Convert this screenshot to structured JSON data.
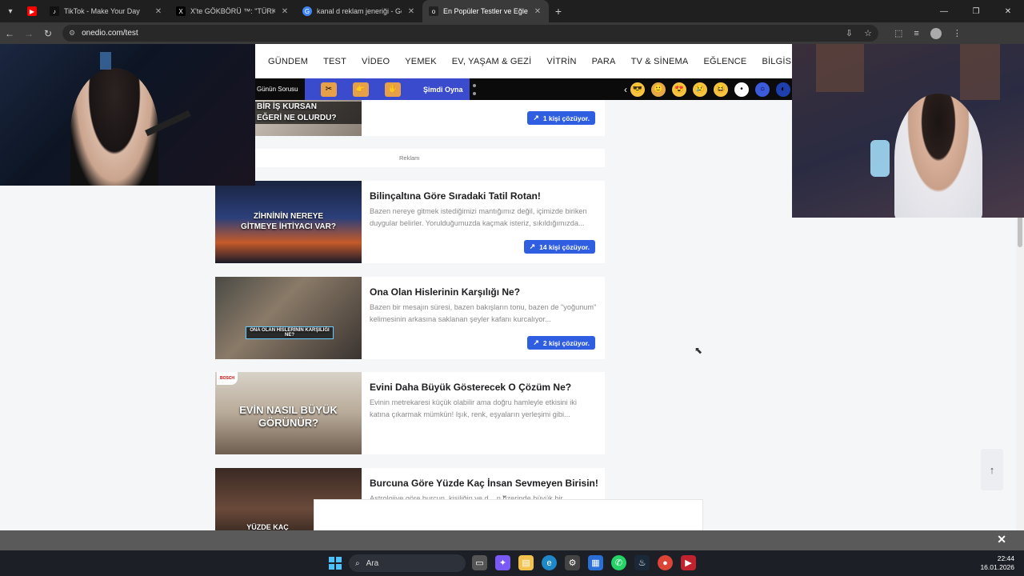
{
  "browser": {
    "tabs": [
      {
        "title": "",
        "favicon": "youtube-icon",
        "color": "#ff0000",
        "active": false
      },
      {
        "title": "TikTok - Make Your Day",
        "favicon": "tiktok-icon",
        "color": "#111111",
        "active": false
      },
      {
        "title": "X'te GÖKBÖRÜ ™: \"TÜRKİYE TÜ",
        "favicon": "x-icon",
        "color": "#000000",
        "active": false
      },
      {
        "title": "kanal d reklam jeneriği - Google",
        "favicon": "google-icon",
        "color": "#4285f4",
        "active": false
      },
      {
        "title": "En Popüler Testler ve Eğlenceli",
        "favicon": "onedio-icon",
        "color": "#222222",
        "active": true
      }
    ],
    "url": "onedio.com/test"
  },
  "nav": {
    "items": [
      "GÜNDEM",
      "TEST",
      "VİDEO",
      "YEMEK",
      "EV, YAŞAM & GEZİ",
      "VİTRİN",
      "PARA",
      "TV & SİNEMA",
      "EĞLENCE",
      "BİLGİSEL"
    ]
  },
  "quizbar": {
    "label": "Günün Sorusu",
    "play_label": "Şimdi Oyna"
  },
  "partial_card": {
    "thumb_text_line1": "BİR İŞ KURSAN",
    "thumb_text_line2": "EĞERİ NE OLURDU?",
    "solver": "1 kişi çözüyor."
  },
  "reklam": "Reklam",
  "cards": [
    {
      "title": "Bilinçaltına Göre Sıradaki Tatil Rotan!",
      "desc": "Bazen nereye gitmek istediğimizi mantığımız değil, içimizde biriken duygular belirler. Yorulduğumuzda kaçmak isteriz, sıkıldığımızda...",
      "solver": "14 kişi çözüyor.",
      "thumb_text": "ZİHNİNİN NEREYE GİTMEYE İHTİYACI VAR?"
    },
    {
      "title": "Ona Olan Hislerinin Karşılığı Ne?",
      "desc": "Bazen bir mesajın süresi, bazen bakışların tonu, bazen de \"yoğunum\" kelimesinin arkasına saklanan şeyler kafanı kurcalıyor...",
      "solver": "2 kişi çözüyor.",
      "thumb_text": "ONA OLAN HİSLERİNİN KARŞILIĞI NE?"
    },
    {
      "title": "Evini Daha Büyük Gösterecek O Çözüm Ne?",
      "desc": "Evinin metrekaresi küçük olabilir ama doğru hamleyle etkisini iki katına çıkarmak mümkün! Işık, renk, eşyaların yerleşimi gibi...",
      "solver": "",
      "thumb_text": "EVİN NASIL BÜYÜK GÖRÜNÜR?",
      "sponsor": "BOSCH"
    },
    {
      "title": "Burcuna Göre Yüzde Kaç İnsan Sevmeyen Birisin!",
      "desc": "Astrolojiye göre burcun, kişiliğin ve d... n üzerinde büyük bir",
      "solver": "",
      "thumb_text": "YÜZDE KAÇ İNSAN SEVMİYORSUN?"
    }
  ],
  "taskbar": {
    "search_label": "Ara",
    "time": "22:44",
    "date": "16.01.2026"
  }
}
